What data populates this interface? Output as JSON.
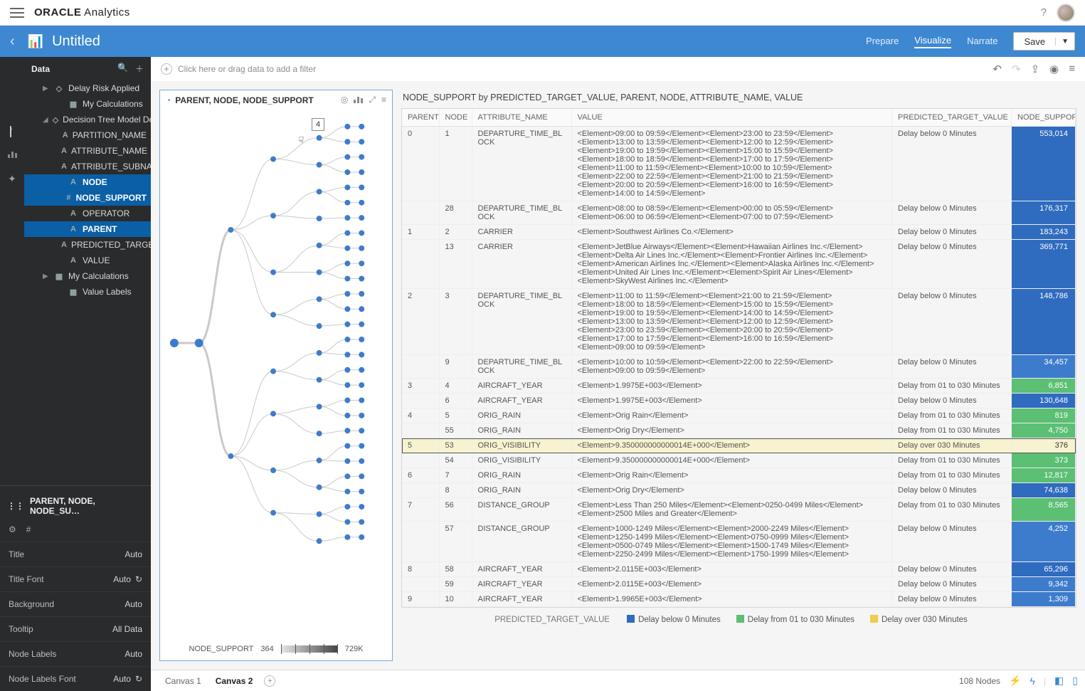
{
  "brand": {
    "strong": "ORACLE",
    "light": " Analytics"
  },
  "titlebar": {
    "title": "Untitled",
    "tabs": {
      "prepare": "Prepare",
      "visualize": "Visualize",
      "narrate": "Narrate"
    },
    "save": "Save"
  },
  "filter_placeholder": "Click here or drag data to add a filter",
  "data_panel": {
    "header": "Data",
    "nodes": [
      {
        "caret": "▶",
        "icon": "◇",
        "label": "Delay Risk Applied",
        "cls": "tree-child"
      },
      {
        "caret": "",
        "icon": "▦",
        "label": "My Calculations",
        "cls": "tree-child2"
      },
      {
        "caret": "◢",
        "icon": "◇",
        "label": "Decision Tree Model Detail…",
        "cls": "tree-child"
      },
      {
        "caret": "",
        "icon": "A",
        "label": "PARTITION_NAME",
        "cls": "tree-child2"
      },
      {
        "caret": "",
        "icon": "A",
        "label": "ATTRIBUTE_NAME",
        "cls": "tree-child2"
      },
      {
        "caret": "",
        "icon": "A",
        "label": "ATTRIBUTE_SUBNAME",
        "cls": "tree-child2"
      },
      {
        "caret": "",
        "icon": "A",
        "label": "NODE",
        "cls": "tree-child2",
        "sel": true
      },
      {
        "caret": "",
        "icon": "#",
        "label": "NODE_SUPPORT",
        "cls": "tree-child2",
        "sel": true
      },
      {
        "caret": "",
        "icon": "A",
        "label": "OPERATOR",
        "cls": "tree-child2"
      },
      {
        "caret": "",
        "icon": "A",
        "label": "PARENT",
        "cls": "tree-child2",
        "sel": true
      },
      {
        "caret": "",
        "icon": "A",
        "label": "PREDICTED_TARGET_…",
        "cls": "tree-child2"
      },
      {
        "caret": "",
        "icon": "A",
        "label": "VALUE",
        "cls": "tree-child2"
      },
      {
        "caret": "▶",
        "icon": "▦",
        "label": "My Calculations",
        "cls": "tree-child"
      },
      {
        "caret": "",
        "icon": "▦",
        "label": "Value Labels",
        "cls": "tree-child2"
      }
    ]
  },
  "grammar_title": "PARENT, NODE, NODE_SU…",
  "props": [
    {
      "k": "Title",
      "v": "Auto"
    },
    {
      "k": "Title Font",
      "v": "Auto",
      "refresh": true
    },
    {
      "k": "Background",
      "v": "Auto"
    },
    {
      "k": "Tooltip",
      "v": "All Data"
    },
    {
      "k": "Node Labels",
      "v": "Auto"
    },
    {
      "k": "Node Labels Font",
      "v": "Auto",
      "refresh": true
    }
  ],
  "tree_viz": {
    "title": "PARENT, NODE, NODE_SUPPORT",
    "popup": "4",
    "footer_label": "NODE_SUPPORT",
    "min": "364",
    "max": "729K"
  },
  "table_viz": {
    "title": "NODE_SUPPORT by PREDICTED_TARGET_VALUE, PARENT, NODE, ATTRIBUTE_NAME, VALUE",
    "columns": [
      "PARENT",
      "NODE",
      "ATTRIBUTE_NAME",
      "VALUE",
      "PREDICTED_TARGET_VALUE",
      "NODE_SUPPORT"
    ],
    "legend_title": "PREDICTED_TARGET_VALUE",
    "legend": [
      {
        "c": "#2f6bbf",
        "t": "Delay below 0 Minutes"
      },
      {
        "c": "#5bbf74",
        "t": "Delay from 01 to 030 Minutes"
      },
      {
        "c": "#f0cc4e",
        "t": "Delay over 030 Minutes"
      }
    ],
    "rows": [
      {
        "p": "0",
        "n": "1",
        "a": "DEPARTURE_TIME_BLOCK",
        "v": "<Element>09:00 to 09:59</Element><Element>23:00 to 23:59</Element><Element>13:00 to 13:59</Element><Element>12:00 to 12:59</Element><Element>19:00 to 19:59</Element><Element>15:00 to 15:59</Element><Element>18:00 to 18:59</Element><Element>17:00 to 17:59</Element><Element>11:00 to 11:59</Element><Element>10:00 to 10:59</Element><Element>22:00 to 22:59</Element><Element>21:00 to 21:59</Element><Element>20:00 to 20:59</Element><Element>16:00 to 16:59</Element><Element>14:00 to 14:59</Element>",
        "t": "Delay below 0 Minutes",
        "ns": "553,014",
        "c": "#2f6bbf"
      },
      {
        "p": "",
        "n": "28",
        "a": "DEPARTURE_TIME_BLOCK",
        "v": "<Element>08:00 to 08:59</Element><Element>00:00 to 05:59</Element><Element>06:00 to 06:59</Element><Element>07:00 to 07:59</Element>",
        "t": "Delay below 0 Minutes",
        "ns": "176,317",
        "c": "#2f6bbf"
      },
      {
        "p": "1",
        "n": "2",
        "a": "CARRIER",
        "v": "<Element>Southwest Airlines Co.</Element>",
        "t": "Delay below 0 Minutes",
        "ns": "183,243",
        "c": "#2f6bbf"
      },
      {
        "p": "",
        "n": "13",
        "a": "CARRIER",
        "v": "<Element>JetBlue Airways</Element><Element>Hawaiian Airlines Inc.</Element><Element>Delta Air Lines Inc.</Element><Element>Frontier Airlines Inc.</Element><Element>American Airlines Inc.</Element><Element>Alaska Airlines Inc.</Element><Element>United Air Lines Inc.</Element><Element>Spirit Air Lines</Element><Element>SkyWest Airlines Inc.</Element>",
        "t": "Delay below 0 Minutes",
        "ns": "369,771",
        "c": "#2f6bbf"
      },
      {
        "p": "2",
        "n": "3",
        "a": "DEPARTURE_TIME_BLOCK",
        "v": "<Element>11:00 to 11:59</Element><Element>21:00 to 21:59</Element><Element>18:00 to 18:59</Element><Element>15:00 to 15:59</Element><Element>19:00 to 19:59</Element><Element>14:00 to 14:59</Element><Element>13:00 to 13:59</Element><Element>12:00 to 12:59</Element><Element>23:00 to 23:59</Element><Element>20:00 to 20:59</Element><Element>17:00 to 17:59</Element><Element>16:00 to 16:59</Element><Element>09:00 to 09:59</Element>",
        "t": "Delay below 0 Minutes",
        "ns": "148,786",
        "c": "#2f6bbf"
      },
      {
        "p": "",
        "n": "9",
        "a": "DEPARTURE_TIME_BLOCK",
        "v": "<Element>10:00 to 10:59</Element><Element>22:00 to 22:59</Element><Element>09:00 to 09:59</Element>",
        "t": "Delay below 0 Minutes",
        "ns": "34,457",
        "c": "#3d7ccc"
      },
      {
        "p": "3",
        "n": "4",
        "a": "AIRCRAFT_YEAR",
        "v": "<Element>1.9975E+003</Element>",
        "t": "Delay from 01 to 030 Minutes",
        "ns": "6,851",
        "c": "#5bbf74"
      },
      {
        "p": "",
        "n": "6",
        "a": "AIRCRAFT_YEAR",
        "v": "<Element>1.9975E+003</Element>",
        "t": "Delay below 0 Minutes",
        "ns": "130,648",
        "c": "#2f6bbf"
      },
      {
        "p": "4",
        "n": "5",
        "a": "ORIG_RAIN",
        "v": "<Element>Orig Rain</Element>",
        "t": "Delay from 01 to 030 Minutes",
        "ns": "819",
        "c": "#5bbf74"
      },
      {
        "p": "",
        "n": "55",
        "a": "ORIG_RAIN",
        "v": "<Element>Orig Dry</Element>",
        "t": "Delay from 01 to 030 Minutes",
        "ns": "4,750",
        "c": "#5bbf74"
      },
      {
        "p": "5",
        "n": "53",
        "a": "ORIG_VISIBILITY",
        "v": "<Element>9.350000000000014E+000</Element>",
        "t": "Delay over 030 Minutes",
        "ns": "376",
        "c": "#f0cc4e",
        "hl": true
      },
      {
        "p": "",
        "n": "54",
        "a": "ORIG_VISIBILITY",
        "v": "<Element>9.350000000000014E+000</Element>",
        "t": "Delay from 01 to 030 Minutes",
        "ns": "373",
        "c": "#5bbf74"
      },
      {
        "p": "6",
        "n": "7",
        "a": "ORIG_RAIN",
        "v": "<Element>Orig Rain</Element>",
        "t": "Delay from 01 to 030 Minutes",
        "ns": "12,817",
        "c": "#5bbf74"
      },
      {
        "p": "",
        "n": "8",
        "a": "ORIG_RAIN",
        "v": "<Element>Orig Dry</Element>",
        "t": "Delay below 0 Minutes",
        "ns": "74,638",
        "c": "#2f6bbf"
      },
      {
        "p": "7",
        "n": "56",
        "a": "DISTANCE_GROUP",
        "v": "<Element>Less Than 250 Miles</Element><Element>0250-0499 Miles</Element><Element>2500 Miles and Greater</Element>",
        "t": "Delay from 01 to 030 Minutes",
        "ns": "8,565",
        "c": "#5bbf74"
      },
      {
        "p": "",
        "n": "57",
        "a": "DISTANCE_GROUP",
        "v": "<Element>1000-1249 Miles</Element><Element>2000-2249 Miles</Element><Element>1250-1499 Miles</Element><Element>0750-0999 Miles</Element><Element>0500-0749 Miles</Element><Element>1500-1749 Miles</Element><Element>2250-2499 Miles</Element><Element>1750-1999 Miles</Element>",
        "t": "Delay below 0 Minutes",
        "ns": "4,252",
        "c": "#3d7ccc"
      },
      {
        "p": "8",
        "n": "58",
        "a": "AIRCRAFT_YEAR",
        "v": "<Element>2.0115E+003</Element>",
        "t": "Delay below 0 Minutes",
        "ns": "65,296",
        "c": "#2f6bbf"
      },
      {
        "p": "",
        "n": "59",
        "a": "AIRCRAFT_YEAR",
        "v": "<Element>2.0115E+003</Element>",
        "t": "Delay below 0 Minutes",
        "ns": "9,342",
        "c": "#3d7ccc"
      },
      {
        "p": "9",
        "n": "10",
        "a": "AIRCRAFT_YEAR",
        "v": "<Element>1.9965E+003</Element>",
        "t": "Delay below 0 Minutes",
        "ns": "1,309",
        "c": "#3d7ccc"
      }
    ]
  },
  "bottom": {
    "c1": "Canvas 1",
    "c2": "Canvas 2",
    "nodes": "108 Nodes"
  },
  "chart_data": {
    "type": "tree",
    "note": "Scatter-style decision-tree dendrogram; x=depth column 0-5, y approximate row ordering, node count ≈108",
    "size_legend": {
      "label": "NODE_SUPPORT",
      "min": 364,
      "max": "729K"
    }
  }
}
